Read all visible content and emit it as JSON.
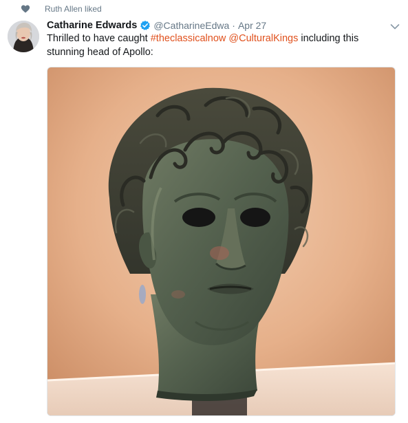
{
  "context": {
    "icon": "heart-icon",
    "label": "Ruth Allen liked"
  },
  "tweet": {
    "author_name": "Catharine Edwards",
    "handle": "@CatharineEdwa",
    "separator": "·",
    "date": "Apr 27",
    "verified_icon": "verified-badge-icon",
    "menu_icon": "chevron-down-icon",
    "text_parts": {
      "lead": "Thrilled to have caught ",
      "hashtag": "#theclassicalnow",
      "mention": "@CulturalKings",
      "tail": " including this stunning head of Apollo:"
    }
  },
  "colors": {
    "link": "#e0501c",
    "verified": "#1da1f2",
    "secondary_text": "#657786"
  },
  "media": {
    "type": "photo",
    "icon": "bronze-head-photo"
  }
}
